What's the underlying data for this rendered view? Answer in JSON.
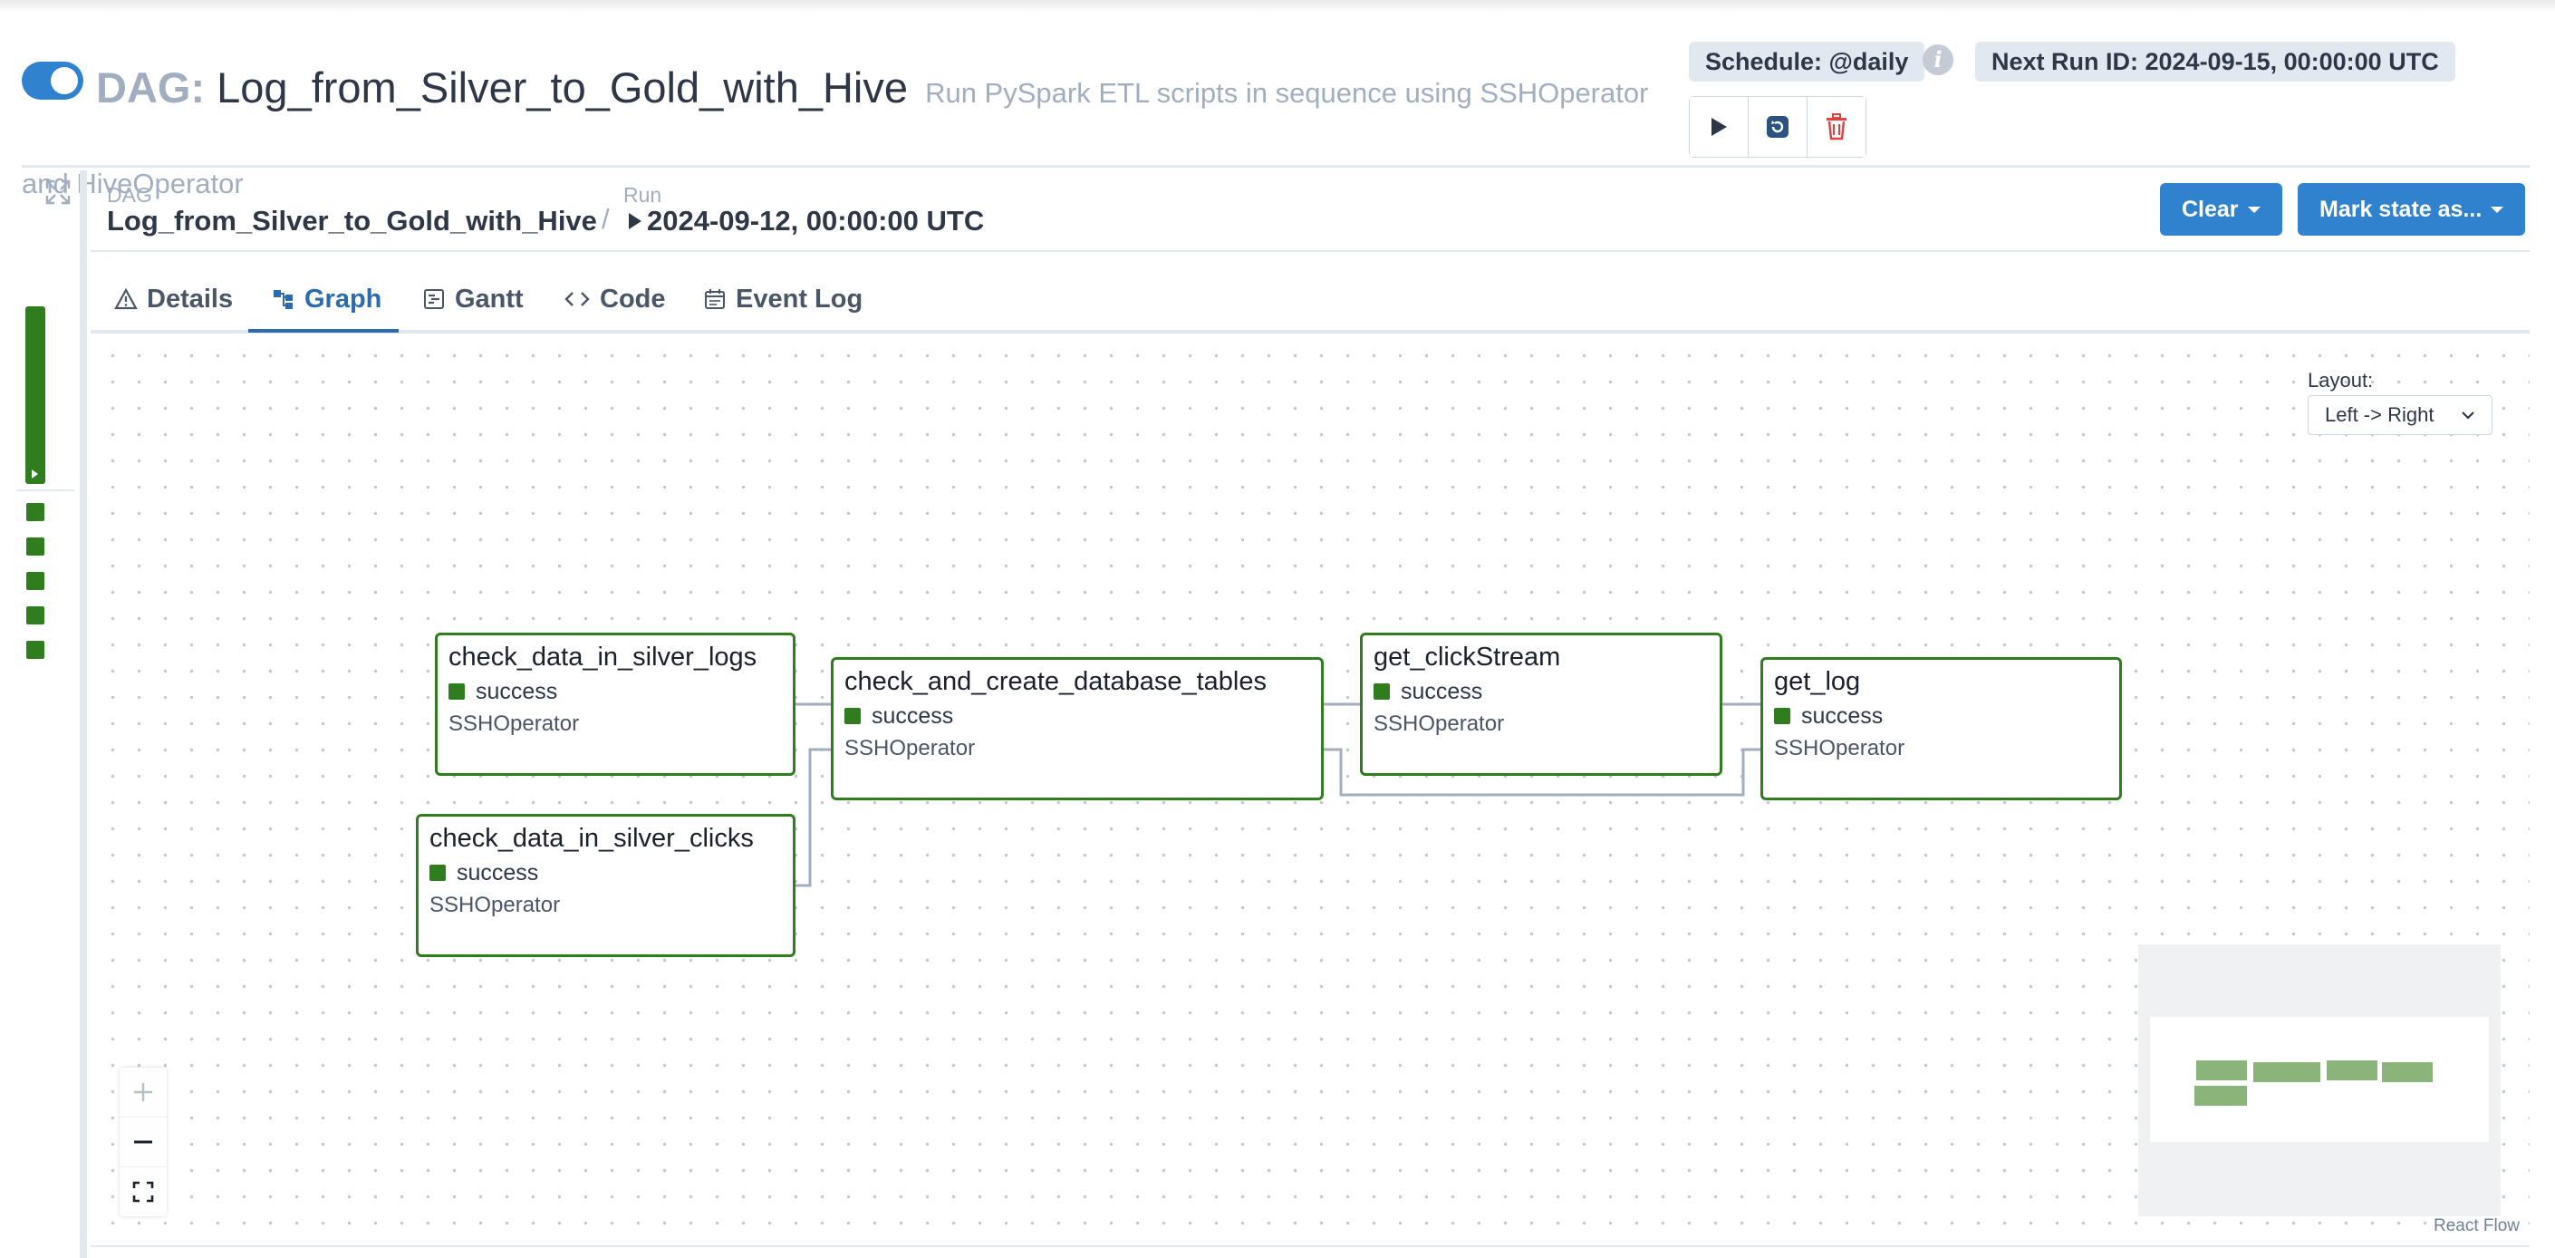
{
  "header": {
    "dag_label": "DAG:",
    "dag_id": "Log_from_Silver_to_Gold_with_Hive",
    "description": "Run PySpark ETL scripts in sequence using SSHOperator and HiveOperator",
    "schedule": "Schedule: @daily",
    "next_run": "Next Run ID: 2024-09-15, 00:00:00 UTC",
    "paused": false,
    "actions": [
      "play-icon",
      "reload-icon",
      "trash-icon"
    ]
  },
  "breadcrumb": {
    "dag_label": "DAG",
    "dag_value": "Log_from_Silver_to_Gold_with_Hive",
    "run_label": "Run",
    "run_value": "2024-09-12, 00:00:00 UTC"
  },
  "buttons": {
    "clear": "Clear",
    "mark_state": "Mark state as..."
  },
  "tabs": [
    {
      "label": "Details",
      "icon": "warning-triangle-icon"
    },
    {
      "label": "Graph",
      "icon": "graph-icon",
      "active": true
    },
    {
      "label": "Gantt",
      "icon": "gantt-icon"
    },
    {
      "label": "Code",
      "icon": "code-icon"
    },
    {
      "label": "Event Log",
      "icon": "calendar-icon"
    }
  ],
  "graph": {
    "layout_label": "Layout:",
    "layout_value": "Left -> Right",
    "nodes": [
      {
        "name": "check_data_in_silver_logs",
        "state": "success",
        "operator": "SSHOperator"
      },
      {
        "name": "check_data_in_silver_clicks",
        "state": "success",
        "operator": "SSHOperator"
      },
      {
        "name": "check_and_create_database_tables",
        "state": "success",
        "operator": "SSHOperator"
      },
      {
        "name": "get_clickStream",
        "state": "success",
        "operator": "SSHOperator"
      },
      {
        "name": "get_log",
        "state": "success",
        "operator": "SSHOperator"
      }
    ],
    "attribution": "React Flow"
  },
  "colors": {
    "success": "#2f7d1f",
    "primary": "#3182ce",
    "edge": "#a0aec0"
  }
}
